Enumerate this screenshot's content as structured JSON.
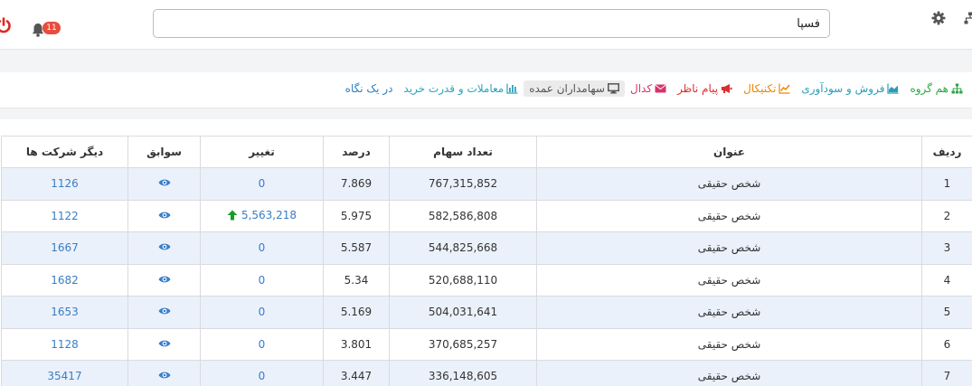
{
  "topbar": {
    "search_value": "فسپا",
    "notification_count": "11"
  },
  "tabs": [
    {
      "label": "در یک نگاه",
      "color": "#2a7fc0",
      "icon": "none",
      "active": false
    },
    {
      "label": "معاملات و قدرت خرید",
      "color": "#2aa4b8",
      "icon": "bar-chart-icon",
      "active": false
    },
    {
      "label": "سهامداران عمده",
      "color": "#555555",
      "icon": "desktop-icon",
      "active": true
    },
    {
      "label": "کدال",
      "color": "#d6336c",
      "icon": "envelope-icon",
      "active": false
    },
    {
      "label": "پیام ناظر",
      "color": "#d9302c",
      "icon": "bullhorn-icon",
      "active": false
    },
    {
      "label": "تکنیکال",
      "color": "#e8890c",
      "icon": "line-chart-icon",
      "active": false
    },
    {
      "label": "فروش و سودآوری",
      "color": "#2a9db5",
      "icon": "area-chart-icon",
      "active": false
    },
    {
      "label": "هم گروه",
      "color": "#28a745",
      "icon": "sitemap-icon",
      "active": false
    }
  ],
  "table": {
    "headers": [
      "ردیف",
      "عنوان",
      "تعداد سهام",
      "درصد",
      "تغییر",
      "سوابق",
      "دیگر شرکت ها"
    ],
    "rows": [
      {
        "row": "1",
        "title": "شخص حقیقی",
        "shares": "767,315,852",
        "percent": "7.869",
        "change": "0",
        "change_up": false,
        "others": "1126"
      },
      {
        "row": "2",
        "title": "شخص حقیقی",
        "shares": "582,586,808",
        "percent": "5.975",
        "change": "5,563,218",
        "change_up": true,
        "others": "1122"
      },
      {
        "row": "3",
        "title": "شخص حقیقی",
        "shares": "544,825,668",
        "percent": "5.587",
        "change": "0",
        "change_up": false,
        "others": "1667"
      },
      {
        "row": "4",
        "title": "شخص حقیقی",
        "shares": "520,688,110",
        "percent": "5.34",
        "change": "0",
        "change_up": false,
        "others": "1682"
      },
      {
        "row": "5",
        "title": "شخص حقیقی",
        "shares": "504,031,641",
        "percent": "5.169",
        "change": "0",
        "change_up": false,
        "others": "1653"
      },
      {
        "row": "6",
        "title": "شخص حقیقی",
        "shares": "370,685,257",
        "percent": "3.801",
        "change": "0",
        "change_up": false,
        "others": "1128"
      },
      {
        "row": "7",
        "title": "شخص حقیقی",
        "shares": "336,148,605",
        "percent": "3.447",
        "change": "0",
        "change_up": false,
        "others": "35417"
      }
    ]
  },
  "colors": {
    "link": "#3a7dc4",
    "up_arrow": "#1a9b2a",
    "row_alt": "#ebf1fb",
    "badge": "#e74c3c"
  }
}
